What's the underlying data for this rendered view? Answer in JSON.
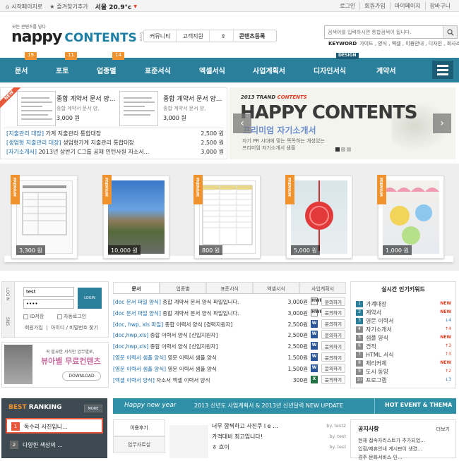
{
  "topbar": {
    "start_page": "시작페이지로",
    "bookmark": "즐겨찾기추가",
    "weather": "서울 20.9°c",
    "login": "로그인",
    "join": "회원가입",
    "mypage": "마이페이지",
    "cart": "장바구니"
  },
  "header": {
    "tagline": "모든 콘텐츠를 담다",
    "logo_main": "nappy",
    "logo_contents": "CONTENTS",
    "logo_side": "Since",
    "nav": [
      "커뮤니티",
      "고객지원",
      "콘텐츠등록"
    ],
    "search_placeholder": "검색어를 입력하시면 통합검색이 됩니다.",
    "keyword_label": "KEYWORD",
    "keywords": "가이드 , 양식 , 엑셀 , 이용안내 , 디자인 , 회사소개"
  },
  "mainnav": {
    "items": [
      "문서",
      "포토",
      "업종별",
      "표준서식",
      "엑셀서식",
      "사업계획서",
      "디자인서식",
      "계약서"
    ],
    "badges": [
      "19",
      "11",
      "14"
    ],
    "design_badge": "DESIGN"
  },
  "products": {
    "ribbon": "NEW",
    "cards": [
      {
        "title": "종합 계약서 문서 양...",
        "desc": "종합 계약서 문서 양,",
        "price": "3,000 원"
      },
      {
        "title": "종합 계약서 문서 양...",
        "desc": "종합 계약서 문서 양,",
        "price": "3,000 원"
      }
    ],
    "list": [
      {
        "cat": "[지출관리 대장]",
        "text": "가계 지출관리 통합대장",
        "price": "2,500 원"
      },
      {
        "cat": "[생업형 지출관리 대장]",
        "text": "생업형가계 지출관리 통합대장",
        "price": "2,500 원"
      },
      {
        "cat": "[자기소개서]",
        "text": "2013년 상반기 C그룹 공채 인턴사원 자소서...",
        "price": "3,000 원"
      }
    ]
  },
  "banner": {
    "year_label": "2013 TRAND",
    "year_highlight": "CONTENTS",
    "title": "HAPPY CONTENTS",
    "subtitle": "프리미엄 자기소개서",
    "desc1": "자기 PR 시대에 맞는 똑똑하는 개성있는",
    "desc2": "프리미엄 자기소개서 샘플",
    "prev": "‹",
    "next": "›"
  },
  "premium": {
    "tag": "PREMIUM",
    "items": [
      {
        "price": "3,300 원"
      },
      {
        "price": "10,000 원"
      },
      {
        "price": "800 원"
      },
      {
        "price": "5,000 원"
      },
      {
        "price": "1,000 원"
      }
    ]
  },
  "login": {
    "tab_login": "LOGIN",
    "tab_sns": "SNS",
    "id_value": "test",
    "pw_value": "••••",
    "button": "LOGIN",
    "save_id": "ID저장",
    "auto_login": "자동로그인",
    "join": "회원가입",
    "find": "아이디 / 비밀번호 찾기"
  },
  "ad": {
    "line1": "꼭 필요한 서식만 업무별로,",
    "line2": "뷰아벨 무료컨텐츠",
    "download": "DOWNLOAD"
  },
  "doc_tabs": [
    "문서",
    "업종별",
    "표준서식",
    "엑셀서식",
    "사업계획서"
  ],
  "docs": [
    {
      "cat": "[doc 문서 파일 양식]",
      "text": "종합 계약서 문서 양식 파일입니다.",
      "price": "3,000원",
      "icon": "HWP",
      "kind": "h",
      "q": "문의하기"
    },
    {
      "cat": "[doc 문서 파일 양식]",
      "text": "종합 계약서 문서 양식 파일입니다.",
      "price": "3,000원",
      "icon": "HWP",
      "kind": "h",
      "q": "문의하기"
    },
    {
      "cat": "[doc, hwp, xls 파일]",
      "text": "종합 이력서 양식 [경력지원자]",
      "price": "2,500원",
      "icon": "W",
      "kind": "w",
      "q": "문의하기"
    },
    {
      "cat": "[doc,hwp,xls]",
      "text": "종합 이력서 양식 [신입지원자]",
      "price": "2,500원",
      "icon": "W",
      "kind": "w",
      "q": "문의하기"
    },
    {
      "cat": "[doc,hwp,xls]",
      "text": "종합 이력서 양식 [신입지원자]",
      "price": "2,500원",
      "icon": "W",
      "kind": "w",
      "q": "문의하기"
    },
    {
      "cat": "[영문 이력서 샘플 양식]",
      "text": "영문 이력서 샘플 양식",
      "price": "1,500원",
      "icon": "W",
      "kind": "w",
      "q": "문의하기"
    },
    {
      "cat": "[영문 이력서 샘플 양식]",
      "text": "영문 이력서 샘플 양식",
      "price": "1,500원",
      "icon": "W",
      "kind": "w",
      "q": "문의하기"
    },
    {
      "cat": "[엑셀 이력서 양식]",
      "text": "자소서 엑셀 이력서 양식",
      "price": "300원",
      "icon": "X",
      "kind": "x",
      "q": "문의하기"
    }
  ],
  "popular": {
    "title": "실시간 인기키워드",
    "items": [
      {
        "n": "1",
        "text": "가계대장",
        "change": "NEW",
        "kind": "new"
      },
      {
        "n": "2",
        "text": "계약서",
        "change": "NEW",
        "kind": "new"
      },
      {
        "n": "3",
        "text": "영문 이력서",
        "change": "↓4",
        "kind": "dn"
      },
      {
        "n": "4",
        "text": "자기소개서",
        "change": "↑4",
        "kind": "up"
      },
      {
        "n": "5",
        "text": "샘플 양식",
        "change": "NEW",
        "kind": "new"
      },
      {
        "n": "6",
        "text": "견적",
        "change": "↑3",
        "kind": "up"
      },
      {
        "n": "7",
        "text": "HTML 서식",
        "change": "↑3",
        "kind": "up"
      },
      {
        "n": "8",
        "text": "체리커체",
        "change": "NEW",
        "kind": "new"
      },
      {
        "n": "9",
        "text": "도시 동양",
        "change": "↑2",
        "kind": "up"
      },
      {
        "n": "10",
        "text": "프로그램",
        "change": "↓3",
        "kind": "dn"
      }
    ]
  },
  "best": {
    "title_a": "BEST",
    "title_b": "RANKING",
    "more": "MORE",
    "items": [
      {
        "n": "1",
        "text": "독수리 사진입니..."
      },
      {
        "n": "2",
        "text": "다양한 색상의 ..."
      }
    ]
  },
  "newyear": {
    "script": "Happy new year",
    "text": "2013 신년도 사업계획서  &  2013년 신년달력  NEW UPDATE",
    "right": "HOT EVENT & THEMA"
  },
  "bottom_tabs": [
    "이용후기",
    "업무자료실"
  ],
  "post": {
    "lines": [
      "너무 깜찍하고 사진쿠 l e ...",
      "가격대비 최고입니다!",
      "ㅎ 흐이"
    ],
    "bylines": [
      "by. test2",
      "by. test",
      "by. test"
    ]
  },
  "notice": {
    "title": "공지사항",
    "more": "더보기",
    "items": [
      "현재 접속자리스트가 추가되었...",
      "입점/제휴안내 게시판이 생겼...",
      "경주 문화서비스 인..."
    ]
  }
}
